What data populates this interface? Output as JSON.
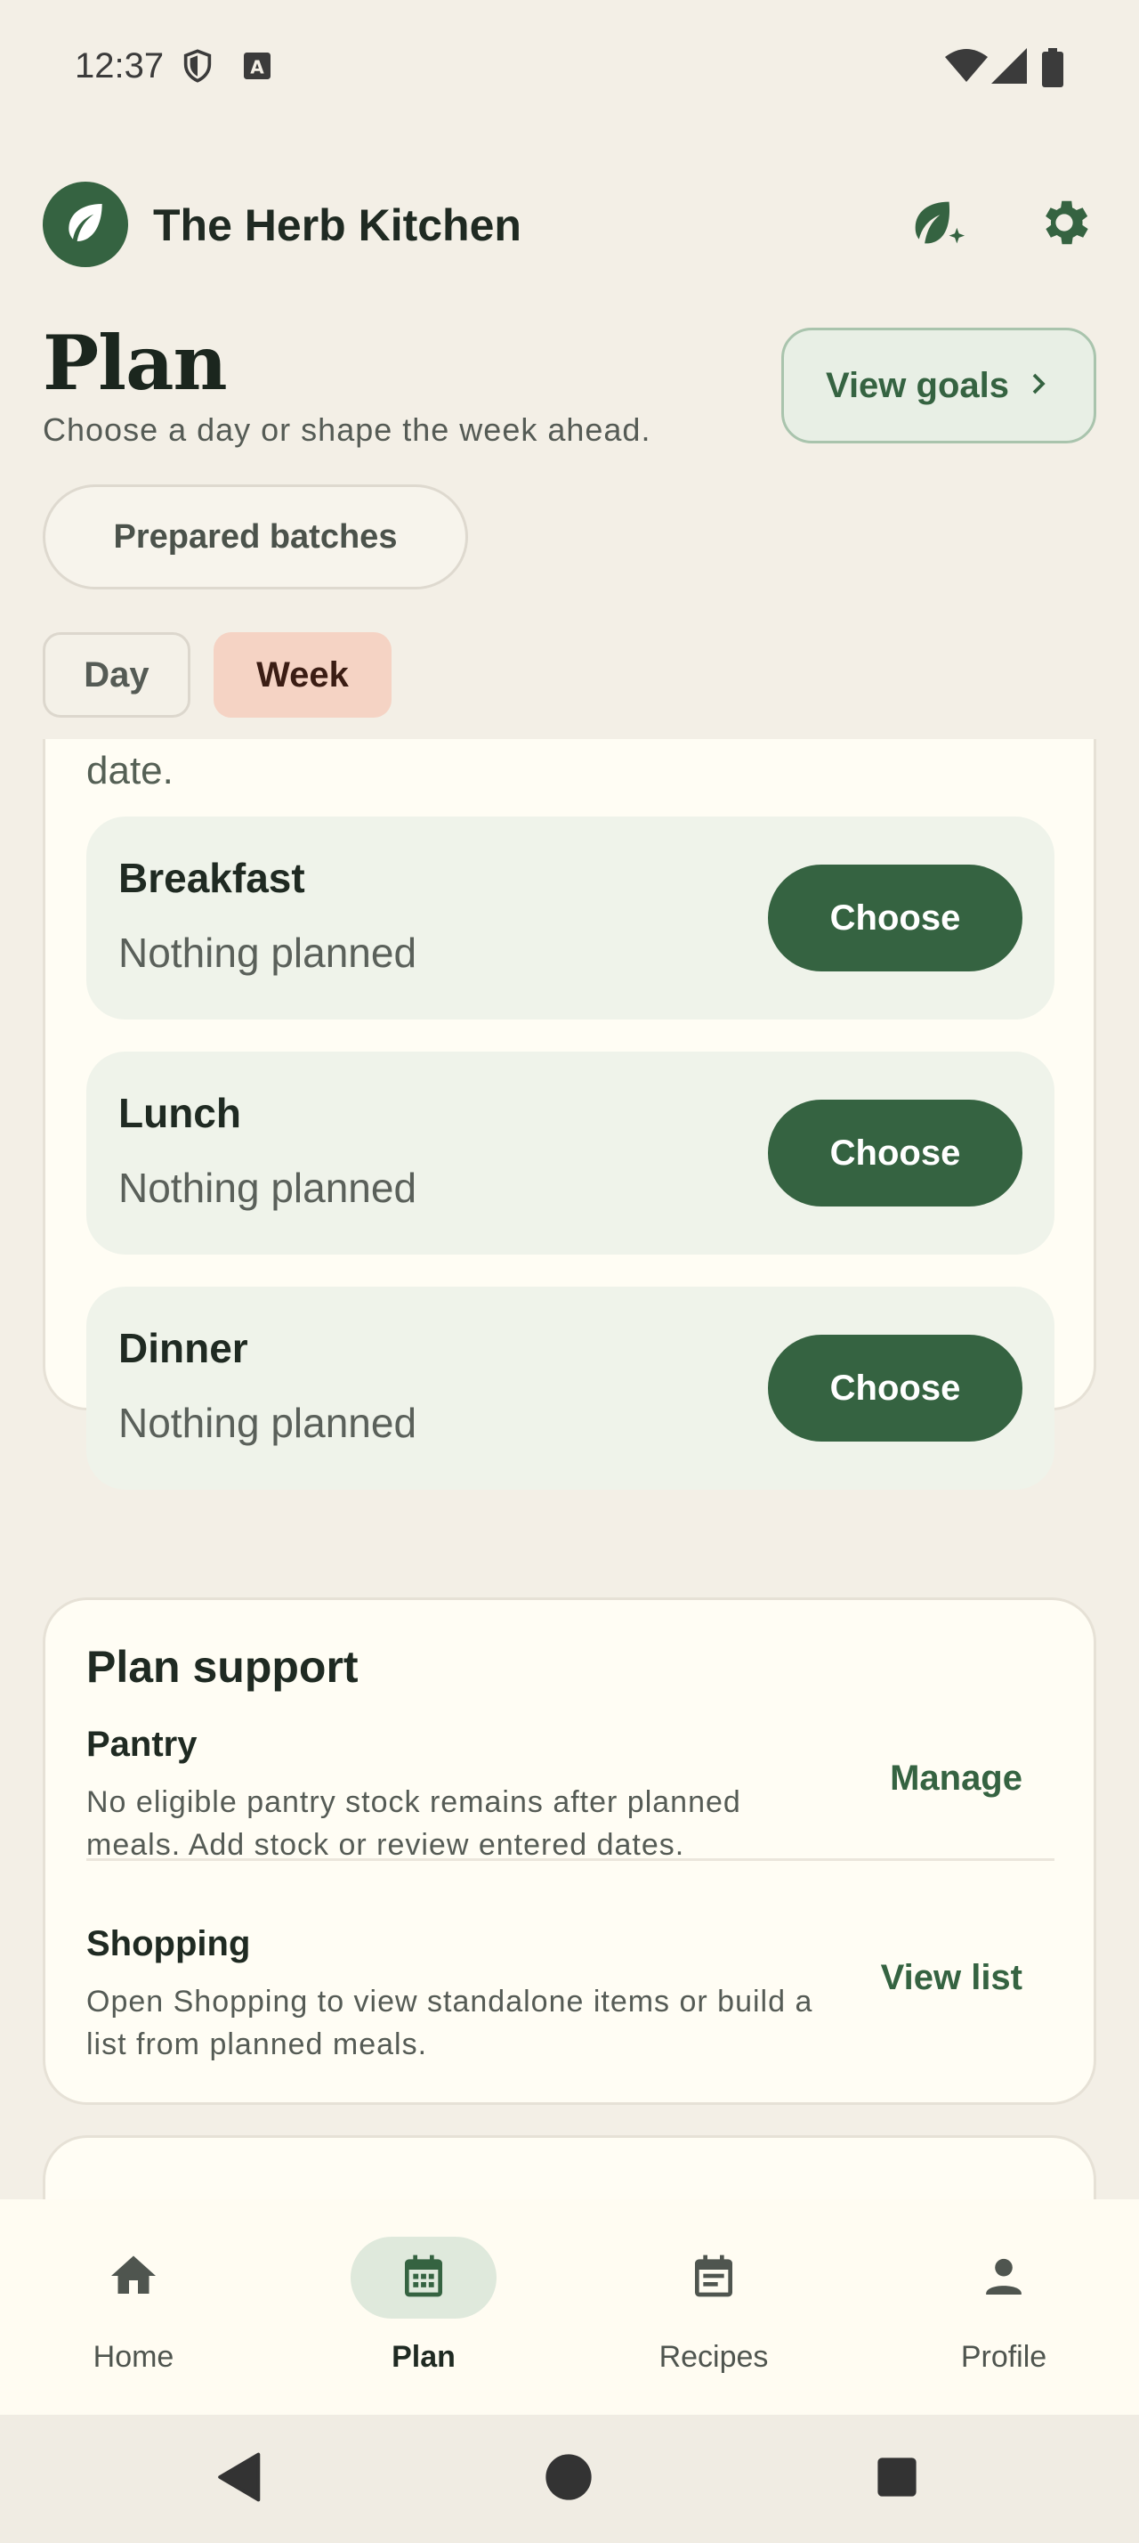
{
  "status_bar": {
    "time": "12:37",
    "icons": [
      "shield-icon",
      "keyboard-a-icon",
      "wifi-icon",
      "cellular-icon",
      "battery-icon"
    ]
  },
  "app": {
    "title": "The Herb Kitchen",
    "logo_icon": "leaf-icon",
    "actions": [
      "leaf-sparkle-icon",
      "gear-icon"
    ]
  },
  "plan": {
    "title": "Plan",
    "subtitle": "Choose a day or shape the week ahead.",
    "view_goals_label": "View goals",
    "prepared_batches_label": "Prepared batches",
    "tabs": [
      {
        "label": "Day",
        "selected": false
      },
      {
        "label": "Week",
        "selected": true
      }
    ]
  },
  "meals_card": {
    "fragment_text": "date.",
    "meals": [
      {
        "name": "Breakfast",
        "status": "Nothing planned",
        "action": "Choose"
      },
      {
        "name": "Lunch",
        "status": "Nothing planned",
        "action": "Choose"
      },
      {
        "name": "Dinner",
        "status": "Nothing planned",
        "action": "Choose"
      }
    ]
  },
  "support": {
    "title": "Plan support",
    "rows": [
      {
        "name": "Pantry",
        "description": "No eligible pantry stock remains after planned meals. Add stock or review entered dates.",
        "action": "Manage"
      },
      {
        "name": "Shopping",
        "description": "Open Shopping to view standalone items or build a list from planned meals.",
        "action": "View list"
      }
    ]
  },
  "bottom_nav": {
    "items": [
      {
        "label": "Home",
        "icon": "home-icon",
        "active": false
      },
      {
        "label": "Plan",
        "icon": "calendar-icon",
        "active": true
      },
      {
        "label": "Recipes",
        "icon": "recipes-icon",
        "active": false
      },
      {
        "label": "Profile",
        "icon": "person-icon",
        "active": false
      }
    ]
  },
  "colors": {
    "brand": "#356341",
    "background": "#f3efe6",
    "card": "#fffdf4",
    "week_tab": "#f5d3c4"
  }
}
